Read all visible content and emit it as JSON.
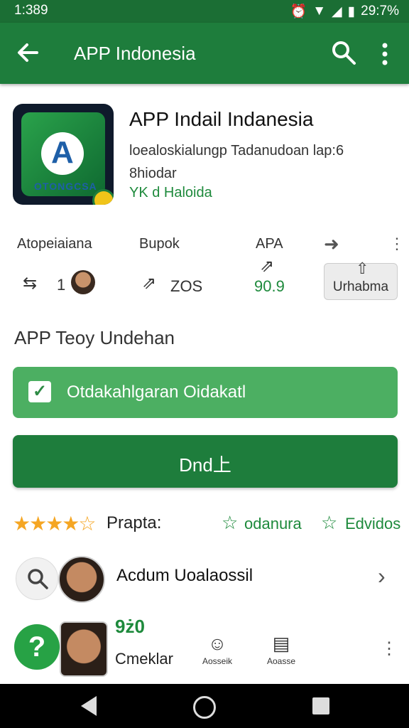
{
  "status": {
    "time": "1:389",
    "battery": "29:7%"
  },
  "toolbar": {
    "title": "APP Indonesia"
  },
  "app": {
    "title": "APP Indail Indanesia",
    "description_line1": "loealoskialungp Tadanudoan lap:6",
    "description_line2": "8hiodar",
    "developer": "YK d Haloida",
    "icon_brand": "OTONGCSA"
  },
  "stats": [
    {
      "label": "Atopeiaiana",
      "value": "1"
    },
    {
      "label": "Bupok",
      "value": "ZOS"
    },
    {
      "label": "APA",
      "value": "90.9"
    }
  ],
  "chip": {
    "label": "Urhabma"
  },
  "section": {
    "title": "APP Teoy Undehan"
  },
  "green_bar": {
    "label": "Otdakahlgaran Oidakatl"
  },
  "install": {
    "label": "Dnd上"
  },
  "rating": {
    "label": "Prapta:",
    "link1": "odanura",
    "link2": "Edvidos"
  },
  "row1": {
    "title": "Acdum Uoalaossil"
  },
  "row2": {
    "label": "Cmeklar",
    "mini": "9ż0",
    "icon1_text": "Aosseik",
    "icon2_text": "Aoasse"
  },
  "colors": {
    "primary": "#1e7d3c",
    "accent": "#4caf62",
    "star": "#f5a623"
  }
}
